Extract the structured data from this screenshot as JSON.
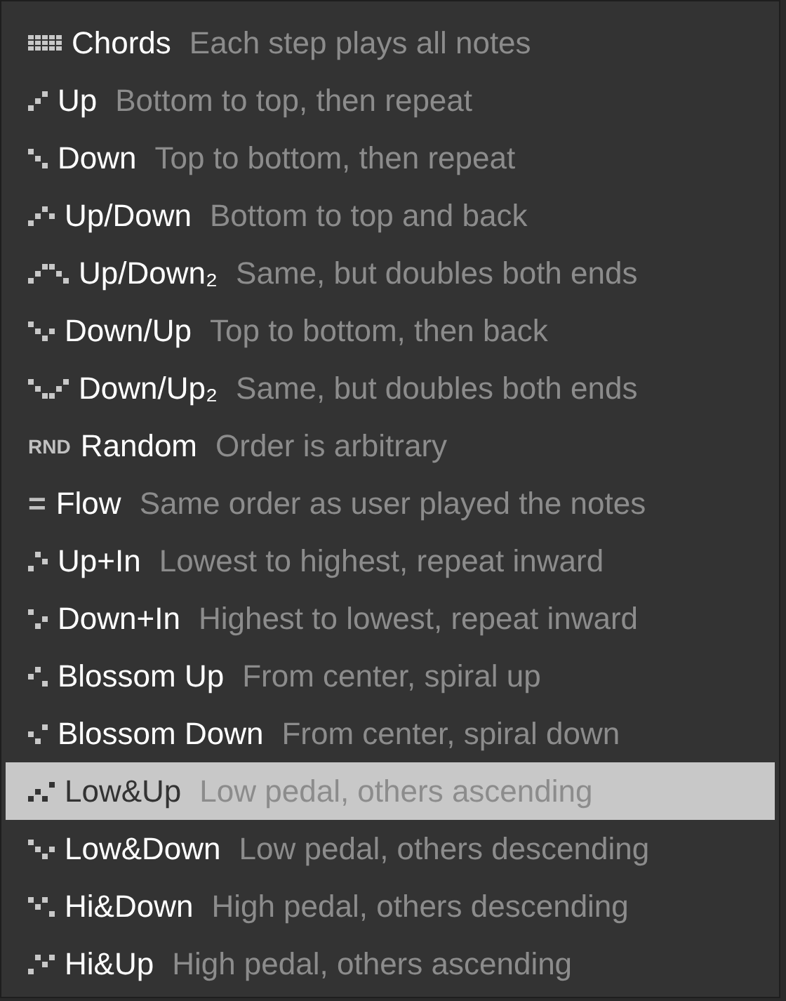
{
  "menu": {
    "items": [
      {
        "kind": "pixels",
        "label": "Chords",
        "description": "Each step plays all notes",
        "selected": false
      },
      {
        "kind": "pixels",
        "label": "Up",
        "description": "Bottom to top, then repeat",
        "selected": false
      },
      {
        "kind": "pixels",
        "label": "Down",
        "description": "Top to bottom, then repeat",
        "selected": false
      },
      {
        "kind": "pixels",
        "label": "Up/Down",
        "description": "Bottom to top and back",
        "selected": false
      },
      {
        "kind": "pixels",
        "label": "Up/Down₂",
        "description": "Same, but doubles both ends",
        "selected": false
      },
      {
        "kind": "pixels",
        "label": "Down/Up",
        "description": "Top to bottom, then back",
        "selected": false
      },
      {
        "kind": "pixels",
        "label": "Down/Up₂",
        "description": "Same, but doubles both ends",
        "selected": false
      },
      {
        "kind": "glyph",
        "glyph": "RND",
        "label": "Random",
        "description": "Order is arbitrary",
        "selected": false
      },
      {
        "kind": "glyph",
        "glyph": "=",
        "label": "Flow",
        "description": "Same order as user played the notes",
        "selected": false
      },
      {
        "kind": "pixels",
        "label": "Up+In",
        "description": "Lowest to highest, repeat inward",
        "selected": false
      },
      {
        "kind": "pixels",
        "label": "Down+In",
        "description": "Highest to lowest, repeat inward",
        "selected": false
      },
      {
        "kind": "pixels",
        "label": "Blossom Up",
        "description": "From center, spiral up",
        "selected": false
      },
      {
        "kind": "pixels",
        "label": "Blossom Down",
        "description": "From center, spiral down",
        "selected": false
      },
      {
        "kind": "pixels",
        "label": "Low&Up",
        "description": "Low pedal, others ascending",
        "selected": true
      },
      {
        "kind": "pixels",
        "label": "Low&Down",
        "description": "Low pedal, others descending",
        "selected": false
      },
      {
        "kind": "pixels",
        "label": "Hi&Down",
        "description": "High pedal, others descending",
        "selected": false
      },
      {
        "kind": "pixels",
        "label": "Hi&Up",
        "description": "High pedal, others ascending",
        "selected": false
      }
    ]
  }
}
